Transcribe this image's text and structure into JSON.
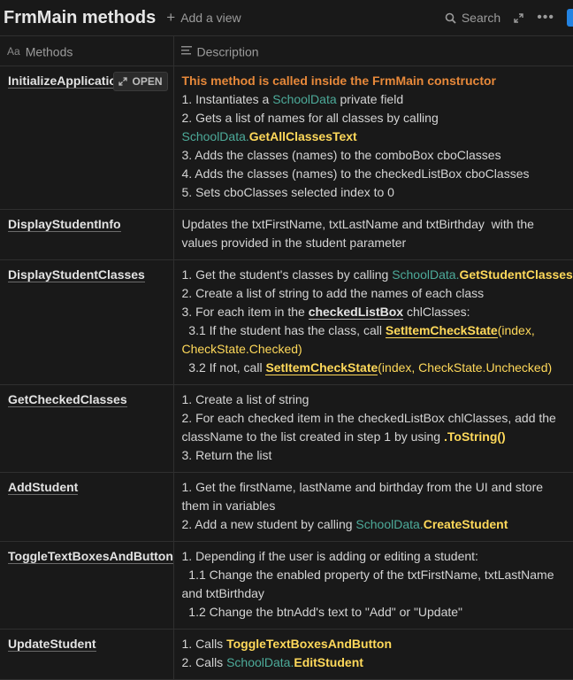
{
  "header": {
    "title": "FrmMain methods",
    "add_view": "Add a view",
    "search": "Search"
  },
  "columns": {
    "methods": "Methods",
    "description": "Description"
  },
  "open_label": "OPEN",
  "rows": [
    {
      "name": "InitializeApplicatio",
      "lines": [
        [
          {
            "t": "This method is called inside the FrmMain constructor",
            "s": "orange"
          }
        ],
        [
          {
            "t": "1. Instantiates a "
          },
          {
            "t": "SchoolData",
            "s": "teal"
          },
          {
            "t": " private field"
          }
        ],
        [
          {
            "t": "2. Gets a list of names for all classes by calling"
          }
        ],
        [
          {
            "t": "SchoolData.",
            "s": "teal"
          },
          {
            "t": "GetAllClassesText",
            "s": "yellow"
          }
        ],
        [
          {
            "t": "3. Adds the classes (names) to the comboBox cboClasses"
          }
        ],
        [
          {
            "t": "4. Adds the classes (names) to the checkedListBox cboClasses"
          }
        ],
        [
          {
            "t": "5. Sets cboClasses selected index to 0"
          }
        ]
      ]
    },
    {
      "name": "DisplayStudentInfo",
      "lines": [
        [
          {
            "t": "Updates the txtFirstName, txtLastName and txtBirthday  with the"
          }
        ],
        [
          {
            "t": "values provided in the student parameter"
          }
        ]
      ]
    },
    {
      "name": "DisplayStudentClasses",
      "lines": [
        [
          {
            "t": "1. Get the student's classes by calling "
          },
          {
            "t": "SchoolData.",
            "s": "teal"
          },
          {
            "t": "GetStudentClasses",
            "s": "yellow"
          }
        ],
        [
          {
            "t": "2. Create a list of string to add the names of each class"
          }
        ],
        [
          {
            "t": "3. For each item in the "
          },
          {
            "t": "checkedListBox",
            "s": "bund"
          },
          {
            "t": " chlClasses:"
          }
        ],
        [
          {
            "t": "  3.1 If the student has the class, call "
          },
          {
            "t": "SetItemCheckState",
            "s": "yund"
          },
          {
            "t": "(index,",
            "s": "yplain"
          }
        ],
        [
          {
            "t": "CheckState.Checked)",
            "s": "yplain"
          }
        ],
        [
          {
            "t": "  3.2 If not, call "
          },
          {
            "t": "SetItemCheckState",
            "s": "yund"
          },
          {
            "t": "(index, CheckState.Unchecked)",
            "s": "yplain"
          }
        ]
      ]
    },
    {
      "name": "GetCheckedClasses",
      "lines": [
        [
          {
            "t": "1. Create a list of string"
          }
        ],
        [
          {
            "t": "2. For each checked item in the checkedListBox chlClasses, add the"
          }
        ],
        [
          {
            "t": "className to the list created in step 1 by using "
          },
          {
            "t": ".ToString()",
            "s": "yellow"
          }
        ],
        [
          {
            "t": "3. Return the list"
          }
        ]
      ]
    },
    {
      "name": "AddStudent",
      "lines": [
        [
          {
            "t": "1. Get the firstName, lastName and birthday from the UI and store"
          }
        ],
        [
          {
            "t": "them in variables"
          }
        ],
        [
          {
            "t": "2. Add a new student by calling "
          },
          {
            "t": "SchoolData.",
            "s": "teal"
          },
          {
            "t": "CreateStudent",
            "s": "yellow"
          }
        ]
      ]
    },
    {
      "name": "ToggleTextBoxesAndButton",
      "lines": [
        [
          {
            "t": "1. Depending if the user is adding or editing a student:"
          }
        ],
        [
          {
            "t": "  1.1 Change the enabled property of the txtFirstName, txtLastName"
          }
        ],
        [
          {
            "t": "and txtBirthday"
          }
        ],
        [
          {
            "t": "  1.2 Change the btnAdd's text to \"Add\" or \"Update\""
          }
        ]
      ]
    },
    {
      "name": "UpdateStudent",
      "lines": [
        [
          {
            "t": "1. Calls "
          },
          {
            "t": "ToggleTextBoxesAndButton",
            "s": "yellow"
          }
        ],
        [
          {
            "t": "2. Calls "
          },
          {
            "t": "SchoolData.",
            "s": "teal"
          },
          {
            "t": "EditStudent",
            "s": "yellow"
          }
        ]
      ]
    }
  ]
}
